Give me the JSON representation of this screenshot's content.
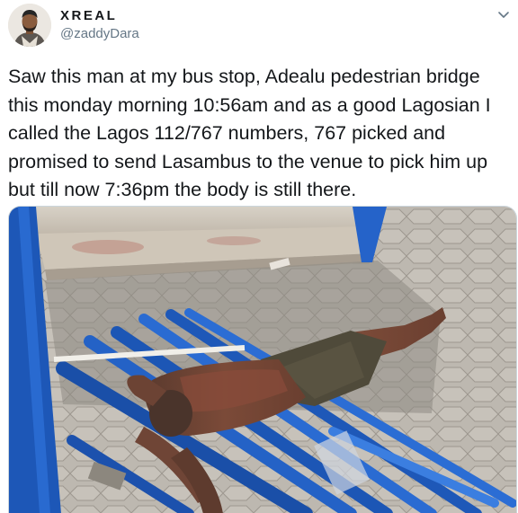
{
  "tweet": {
    "display_name": "XREAL",
    "handle": "@zaddyDara",
    "text": "Saw this man at my bus stop, Adealu pedestrian bridge this monday morning 10:56am and as a good Lagosian I called the Lagos 112/767 numbers, 767 picked and promised to send Lasambus to the venue to pick him up but till now 7:36pm the body is still there.",
    "icons": {
      "menu": "chevron-down-icon",
      "avatar": "avatar"
    }
  },
  "colors": {
    "text": "#14171a",
    "secondary": "#657786",
    "border": "#ccd6dd",
    "blue_structure": "#1e5fc4"
  }
}
